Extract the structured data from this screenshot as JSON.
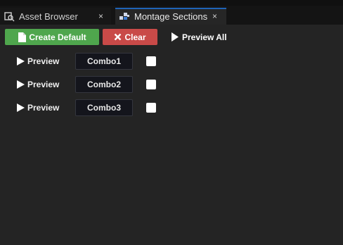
{
  "tabs": [
    {
      "label": "Asset Browser",
      "icon": "asset-browser-icon",
      "close": "×"
    },
    {
      "label": "Montage Sections",
      "icon": "montage-sections-icon",
      "close": "×"
    }
  ],
  "toolbar": {
    "create_default_label": "Create Default",
    "clear_label": "Clear",
    "preview_all_label": "Preview All"
  },
  "sections": [
    {
      "preview_label": "Preview",
      "name": "Combo1",
      "checked": false
    },
    {
      "preview_label": "Preview",
      "name": "Combo2",
      "checked": false
    },
    {
      "preview_label": "Preview",
      "name": "Combo3",
      "checked": false
    }
  ],
  "colors": {
    "create_default": "#4fa64d",
    "clear": "#c94a48",
    "active_tab_accent": "#1f6fd1"
  }
}
